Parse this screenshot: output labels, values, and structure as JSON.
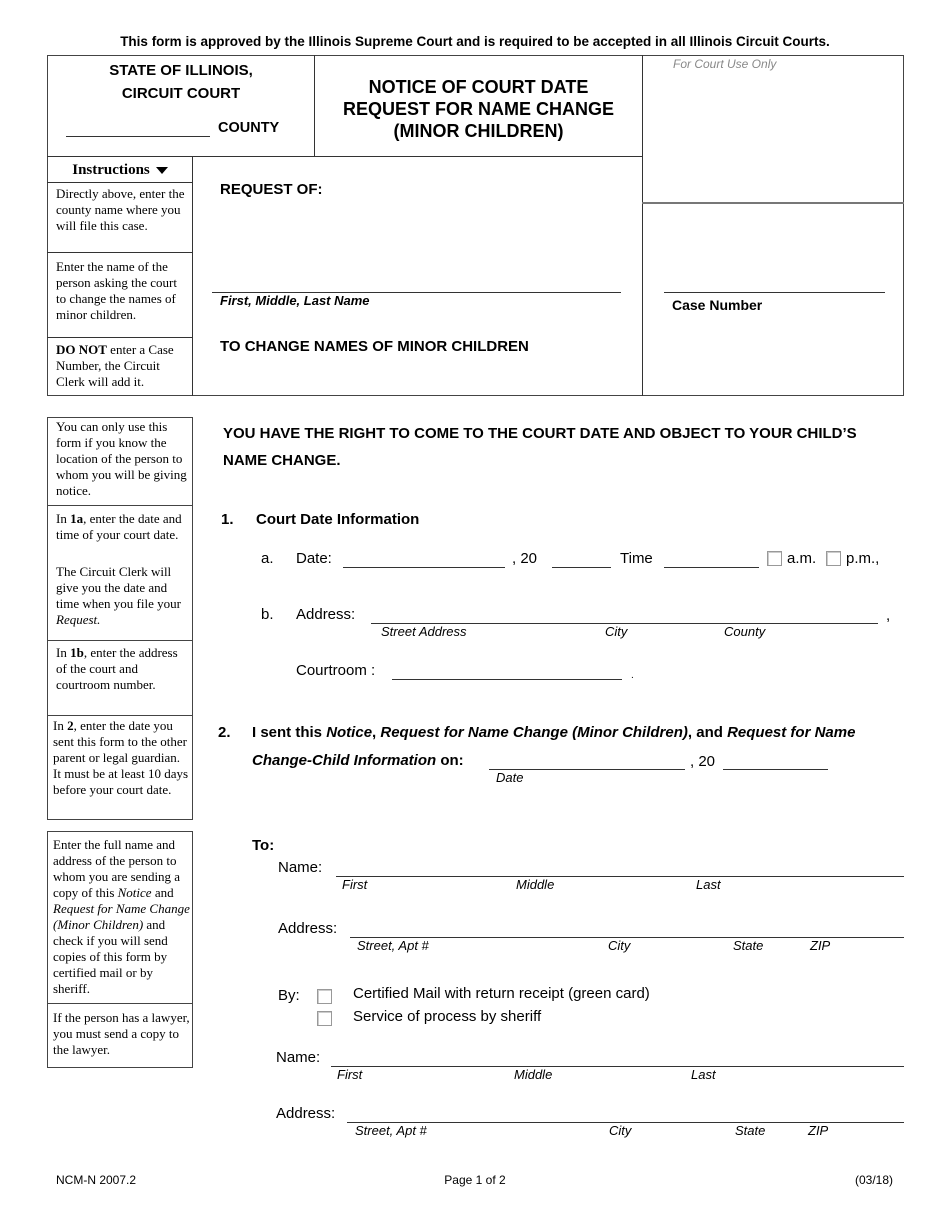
{
  "top_notice": "This form is approved by the Illinois Supreme Court and is required to be accepted in all Illinois Circuit Courts.",
  "header": {
    "state_line1": "STATE OF ILLINOIS,",
    "state_line2": "CIRCUIT COURT",
    "county_label": "COUNTY",
    "county_value": "",
    "title_line1": "NOTICE OF COURT DATE",
    "title_line2": "REQUEST FOR NAME CHANGE",
    "title_line3": "(MINOR CHILDREN)",
    "court_use_only": "For Court Use Only",
    "request_of": "REQUEST OF:",
    "name_value": "",
    "name_caption": "First, Middle, Last Name",
    "change_names": "TO CHANGE NAMES OF MINOR CHILDREN",
    "case_number_value": "",
    "case_number_label": "Case Number"
  },
  "instructions": {
    "heading": "Instructions",
    "items": [
      "Directly above, enter the county name where you will file this case.",
      "Enter the name of the person asking the court to change the names of minor children.",
      {
        "bold": "DO NOT",
        "rest": " enter a Case Number, the Circuit Clerk will add it."
      }
    ]
  },
  "side_notes": {
    "note1": "You can only use this form if you know the location of the person to whom you will be giving notice.",
    "note2_pre": "In ",
    "note2_bold": "1a",
    "note2_post": ", enter the date and time of your court date.",
    "note2b_pre": "The Circuit Clerk will give you the date and time when you file your ",
    "note2b_ital": "Request.",
    "note3_pre": "In ",
    "note3_bold": "1b",
    "note3_post": ", enter the address of the court and courtroom number.",
    "note4_pre": "In ",
    "note4_bold": "2",
    "note4_post": ", enter the date you sent this form to the other parent or legal guardian. It must be at least 10 days before your court date.",
    "note5_a": "Enter the full name and address of the person to whom you are sending a copy of this ",
    "note5_b": "Notice",
    "note5_c": " and ",
    "note5_d": "Request for Name Change (Minor Children)",
    "note5_e": " and check if you will send copies of this form by certified mail or by sheriff.",
    "note6": "If the person has a lawyer, you must send a copy to the lawyer."
  },
  "rights_statement": "YOU HAVE THE RIGHT TO COME TO THE COURT DATE AND OBJECT TO YOUR CHILD’S NAME CHANGE.",
  "section1": {
    "number": "1.",
    "title": "Court Date Information",
    "a": {
      "letter": "a.",
      "date_label": "Date:",
      "date_value": "",
      "year_prefix": ", 20",
      "year_value": "",
      "time_label": "Time",
      "time_value": "",
      "am_label": "a.m.",
      "pm_label": "p.m.,",
      "am_checked": false,
      "pm_checked": false
    },
    "b": {
      "letter": "b.",
      "address_label": "Address:",
      "address_value": "",
      "trailing_comma": ",",
      "cap_street": "Street Address",
      "cap_city": "City",
      "cap_county": "County",
      "courtroom_label": "Courtroom :",
      "courtroom_value": "",
      "trailing_period": "."
    }
  },
  "section2": {
    "number": "2.",
    "text_1": "I sent this ",
    "text_2": "Notice",
    "text_3": ", ",
    "text_4": "Request for Name Change (Minor Children)",
    "text_5": ", and ",
    "text_6": "Request for Name",
    "text_7": "Change-Child Information",
    "text_8": " on:",
    "date_value": "",
    "date_caption": "Date",
    "year_prefix": ", 20",
    "year_value": ""
  },
  "to_section": {
    "label": "To:",
    "recipients": [
      {
        "name_label": "Name:",
        "name_value": "",
        "cap_first": "First",
        "cap_middle": "Middle",
        "cap_last": "Last",
        "address_label": "Address:",
        "address_value": "",
        "cap_street": "Street, Apt #",
        "cap_city": "City",
        "cap_state": "State",
        "cap_zip": "ZIP"
      },
      {
        "name_label": "Name:",
        "name_value": "",
        "cap_first": "First",
        "cap_middle": "Middle",
        "cap_last": "Last",
        "address_label": "Address:",
        "address_value": "",
        "cap_street": "Street, Apt #",
        "cap_city": "City",
        "cap_state": "State",
        "cap_zip": "ZIP"
      }
    ],
    "by_label": "By:",
    "options": [
      {
        "label": "Certified Mail with return receipt (green card)",
        "checked": false
      },
      {
        "label": "Service of process by sheriff",
        "checked": false
      }
    ]
  },
  "footer": {
    "form_code": "NCM-N 2007.2",
    "page": "Page 1 of 2",
    "revision": "(03/18)"
  }
}
